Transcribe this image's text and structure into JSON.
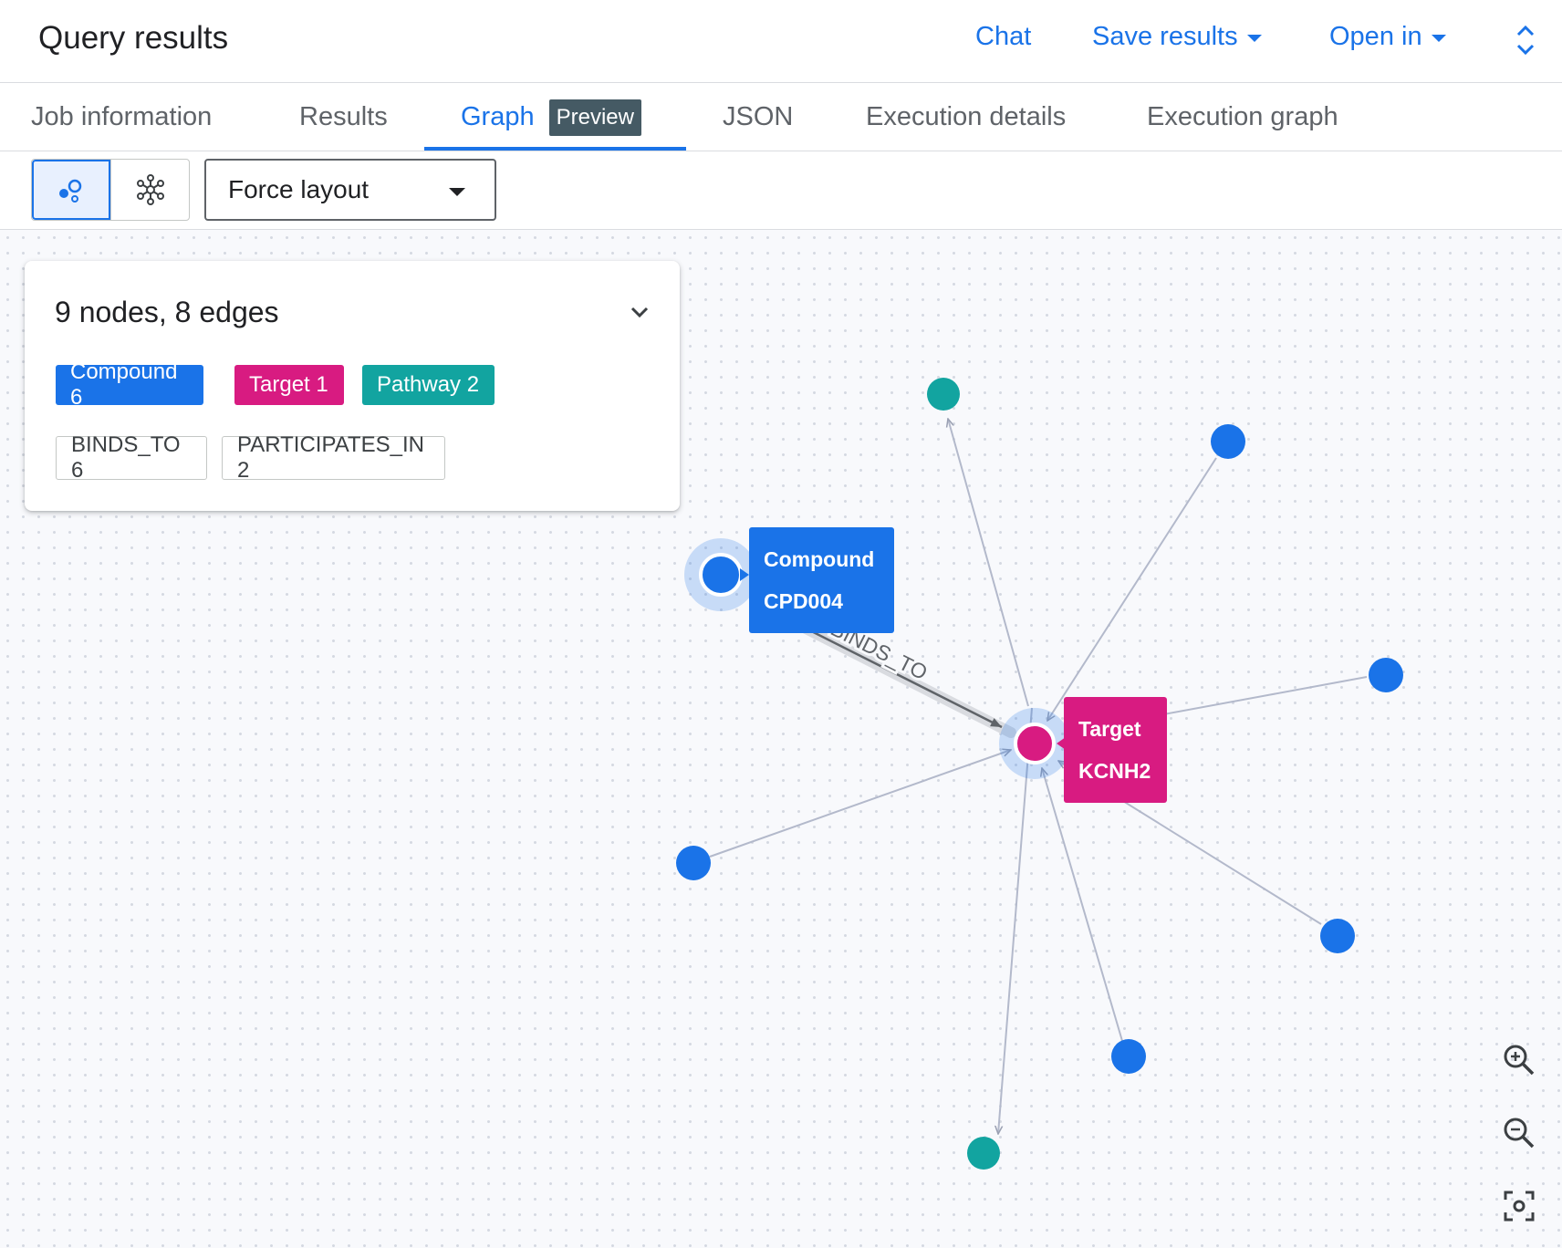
{
  "header": {
    "title": "Query results",
    "chat_label": "Chat",
    "save_label": "Save results",
    "open_label": "Open in"
  },
  "tabs": [
    {
      "label": "Job information"
    },
    {
      "label": "Results"
    },
    {
      "label": "Graph",
      "badge": "Preview"
    },
    {
      "label": "JSON"
    },
    {
      "label": "Execution details"
    },
    {
      "label": "Execution graph"
    }
  ],
  "toolbar": {
    "layout_value": "Force layout",
    "view_icons": [
      "node-view-icon",
      "network-view-icon"
    ]
  },
  "summary": {
    "title": "9 nodes, 8 edges",
    "node_chips": [
      {
        "label": "Compound",
        "count": "6",
        "text": "Compound 6",
        "color": "#1a73e8"
      },
      {
        "label": "Target",
        "count": "1",
        "text": "Target 1",
        "color": "#d81b81"
      },
      {
        "label": "Pathway",
        "count": "2",
        "text": "Pathway 2",
        "color": "#12a4a0"
      }
    ],
    "edge_chips": [
      {
        "label": "BINDS_TO",
        "count": "6",
        "text": "BINDS_TO 6"
      },
      {
        "label": "PARTICIPATES_IN",
        "count": "2",
        "text": "PARTICIPATES_IN 2"
      }
    ]
  },
  "graph": {
    "colors": {
      "compound": "#1a73e8",
      "target": "#d81b81",
      "pathway": "#12a4a0",
      "edge": "#b3b9cb"
    },
    "selected_edge_label": "BINDS_TO",
    "tooltips": {
      "compound": {
        "type": "Compound",
        "id": "CPD004"
      },
      "target": {
        "type": "Target",
        "id": "KCNH2"
      }
    }
  },
  "zoom": {
    "icons": [
      "zoom-in-icon",
      "zoom-out-icon",
      "fit-view-icon"
    ]
  }
}
